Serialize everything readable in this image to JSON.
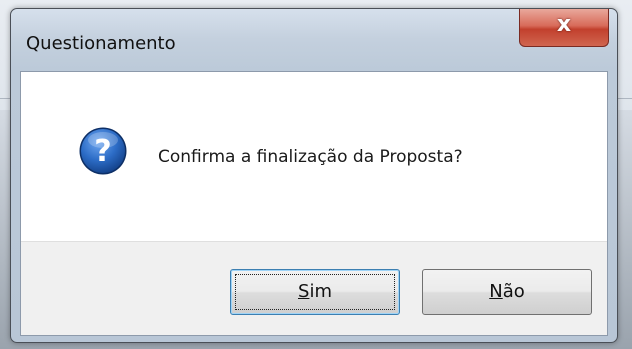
{
  "dialog": {
    "title": "Questionamento",
    "close_glyph": "x",
    "message": "Confirma a finalização da Proposta?",
    "icon": "question-icon",
    "buttons": [
      {
        "label_first": "S",
        "label_rest": "im",
        "mnemonic": "S",
        "focused": true
      },
      {
        "label_first": "N",
        "label_rest": "ão",
        "mnemonic": "N",
        "focused": false
      }
    ]
  },
  "colors": {
    "close_button": "#c2402d",
    "icon_blue": "#1f5fb3",
    "focus_border": "#3c7fb1"
  }
}
